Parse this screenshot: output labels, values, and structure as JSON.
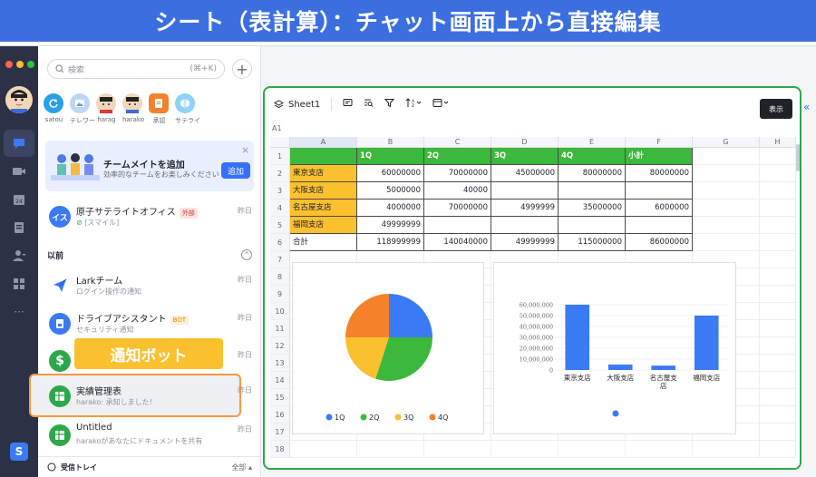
{
  "banner": {
    "title": "シート（表計算）：チャット画面上から直接編集"
  },
  "colors": {
    "accent": "#3370ff",
    "banner": "#3b6fe0",
    "green": "#3cb83c",
    "orange": "#fbc02d",
    "frame": "#2ca84a",
    "highlight": "#f6993f"
  },
  "rail": {
    "shortcut_letter": "S"
  },
  "search": {
    "placeholder": "検索",
    "shortcut": "(⌘+K)"
  },
  "quick": [
    {
      "label": "satou",
      "color": "#29a0e8",
      "icon": "refresh-icon"
    },
    {
      "label": "テレワー",
      "color": "#bcd7f3",
      "icon": "image-icon"
    },
    {
      "label": "harag",
      "color": "#ffffff",
      "icon": "person-icon"
    },
    {
      "label": "harako",
      "color": "#ffffff",
      "icon": "person-icon"
    },
    {
      "label": "承認",
      "color": "#f5822a",
      "icon": "approval-icon"
    },
    {
      "label": "サテライ",
      "color": "#8fd3f5",
      "icon": "cube-icon"
    }
  ],
  "promo": {
    "title": "チームメイトを追加",
    "subtitle": "効率的なチームをお楽しみください",
    "button": "追加",
    "close": "×"
  },
  "chats": [
    {
      "name": "原子サテライトオフィス",
      "tag": "外部",
      "sub": "[スマイル]",
      "time": "昨日",
      "icon_text": "イス",
      "color": "#3b7af5"
    },
    {
      "name": "Larkチーム",
      "tag": "",
      "sub": "ログイン操作の通知",
      "time": "昨日",
      "icon_text": "",
      "color": "#ffffff"
    },
    {
      "name": "ドライブアシスタント",
      "tag": "BOT",
      "sub": "セキュリティ通知",
      "time": "昨日",
      "icon_text": "",
      "color": "#3b7af5"
    },
    {
      "name": "",
      "tag": "",
      "sub": "",
      "time": "昨日",
      "icon_text": "$",
      "color": "#2ca84a"
    },
    {
      "name": "実績管理表",
      "tag": "",
      "sub": "harako: 承知しました！",
      "time": "昨日",
      "icon_text": "",
      "color": "#2ca84a"
    },
    {
      "name": "Untitled",
      "tag": "",
      "sub": "harakoがあなたにドキュメントを共有",
      "time": "昨日",
      "icon_text": "",
      "color": "#2ca84a"
    }
  ],
  "section": {
    "label": "以前"
  },
  "callout": {
    "label": "通知ボット"
  },
  "inbox": {
    "label": "受信トレイ",
    "filter": "全部"
  },
  "sheet": {
    "tab": "Sheet1",
    "tooltip": "表示",
    "cell_ref": "A1",
    "columns": [
      "A",
      "B",
      "C",
      "D",
      "E",
      "F",
      "G",
      "H"
    ],
    "rows": [
      "1",
      "2",
      "3",
      "4",
      "5",
      "6",
      "7",
      "8",
      "9",
      "10",
      "11",
      "12",
      "13",
      "14",
      "15",
      "16",
      "17",
      "18"
    ],
    "header": [
      "",
      "1Q",
      "2Q",
      "3Q",
      "4Q",
      "小計"
    ],
    "data": [
      [
        "東京支店",
        "60000000",
        "70000000",
        "45000000",
        "80000000",
        "80000000"
      ],
      [
        "大阪支店",
        "5000000",
        "40000",
        "",
        "",
        ""
      ],
      [
        "名古屋支店",
        "4000000",
        "70000000",
        "4999999",
        "35000000",
        "6000000"
      ],
      [
        "福岡支店",
        "49999999",
        "",
        "",
        "",
        ""
      ],
      [
        "合計",
        "118999999",
        "140040000",
        "49999999",
        "115000000",
        "86000000"
      ]
    ]
  },
  "chart_data": [
    {
      "type": "pie",
      "title": "",
      "categories": [
        "1Q",
        "2Q",
        "3Q",
        "4Q"
      ],
      "values": [
        25,
        30,
        20,
        25
      ],
      "colors": [
        "#3b7af5",
        "#3cb83c",
        "#fbc02d",
        "#f5822a"
      ],
      "legend": "bottom"
    },
    {
      "type": "bar",
      "title": "",
      "categories": [
        "東京支店",
        "大阪支店",
        "名古屋支店",
        "福岡支店"
      ],
      "values": [
        60000000,
        5000000,
        4000000,
        49999999
      ],
      "ylim": [
        0,
        60000000
      ],
      "yticks": [
        "0",
        "10,000,000",
        "20,000,000",
        "30,000,000",
        "40,000,000",
        "50,000,000",
        "60,000,000"
      ],
      "color": "#3b7af5",
      "legend": "bottom"
    }
  ]
}
